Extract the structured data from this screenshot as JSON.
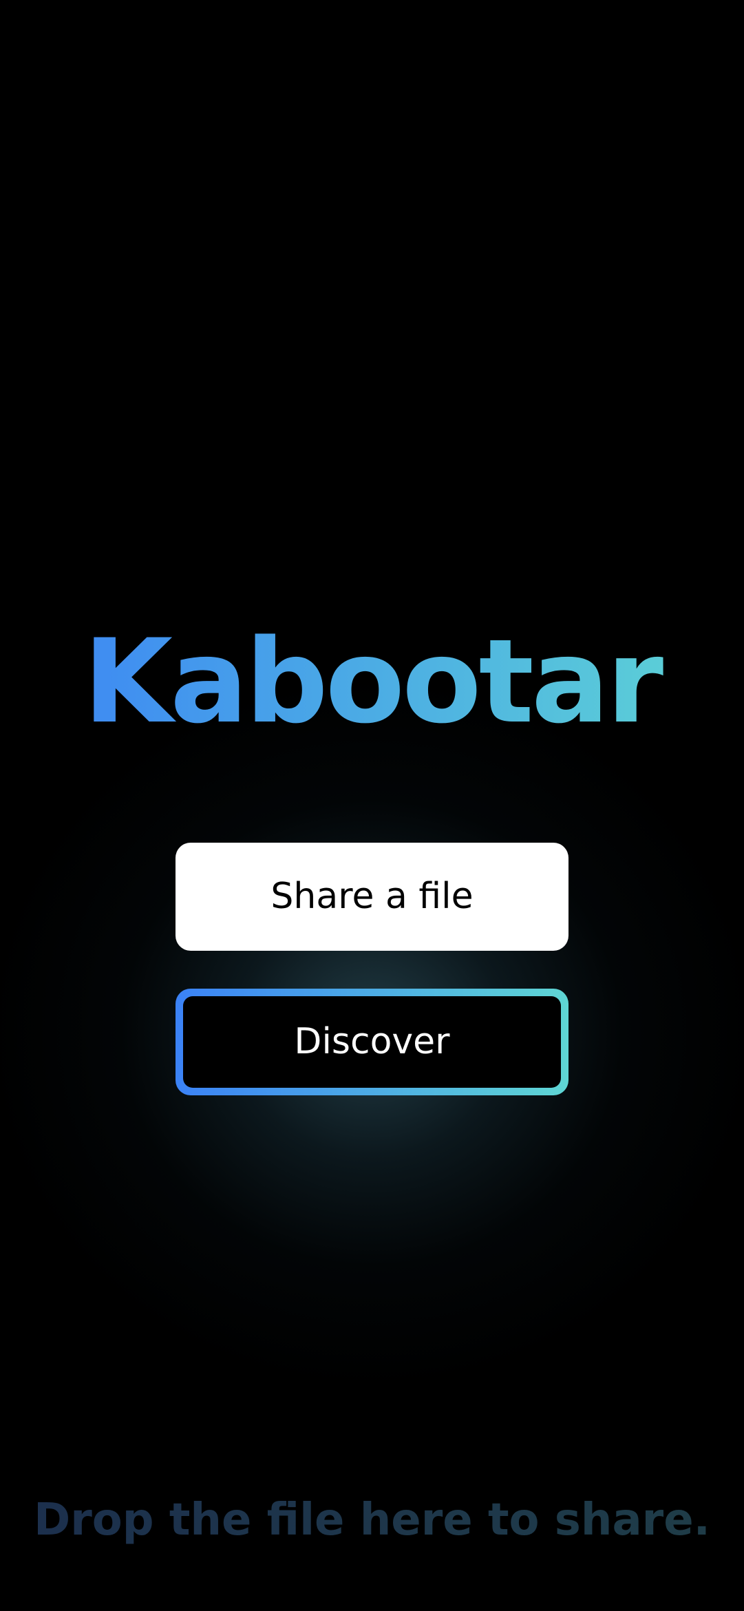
{
  "app": {
    "title": "Kabootar"
  },
  "actions": {
    "share_label": "Share a file",
    "discover_label": "Discover"
  },
  "footer": {
    "drop_hint": "Drop the file here to share."
  },
  "colors": {
    "background": "#000000",
    "gradient_start": "#3b82f6",
    "gradient_end": "#5fd6d4",
    "share_button_bg": "#ffffff",
    "drop_hint_color": "#1d3448"
  }
}
